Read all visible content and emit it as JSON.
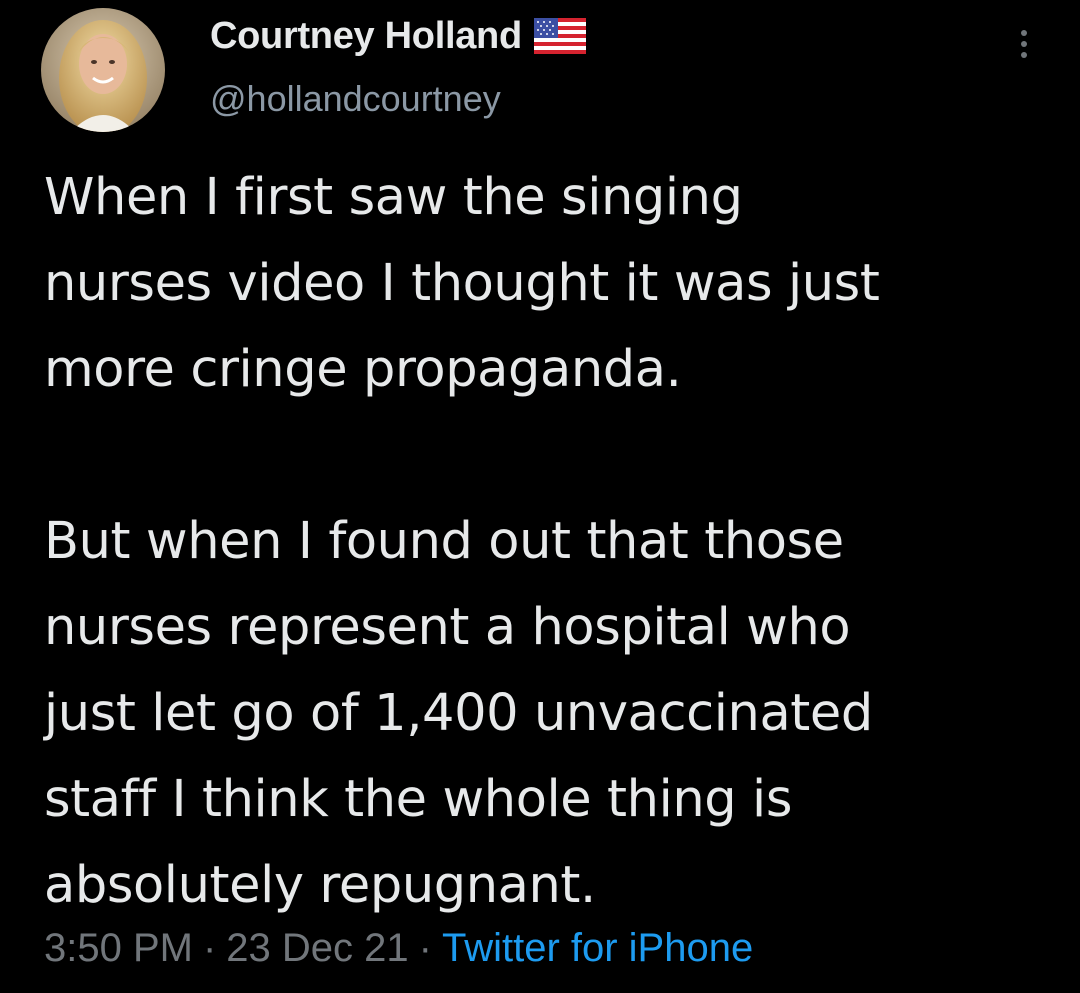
{
  "author": {
    "display_name": "Courtney Holland",
    "handle": "@hollandcourtney",
    "flag_icon": "us-flag-icon"
  },
  "tweet": {
    "paragraphs": [
      "When I first saw the singing nurses video I thought it was just more cringe propaganda.",
      "But when I found out that those nurses represent a hospital who just let go of 1,400 unvaccinated staff I think the whole thing is absolutely repugnant."
    ],
    "lines_p1": [
      "When I first saw the singing",
      "nurses video I thought it was just",
      "more cringe propaganda."
    ],
    "lines_p2": [
      "But when I found out that those",
      "nurses represent a hospital who",
      "just let go of 1,400 unvaccinated",
      "staff I think the whole thing is",
      "absolutely repugnant."
    ]
  },
  "meta": {
    "time": "3:50 PM",
    "separator": "·",
    "date": "23 Dec 21",
    "source": "Twitter for iPhone"
  },
  "colors": {
    "background": "#000000",
    "text": "#e7e9ea",
    "secondary": "#71767b",
    "link": "#1d9bf0"
  }
}
